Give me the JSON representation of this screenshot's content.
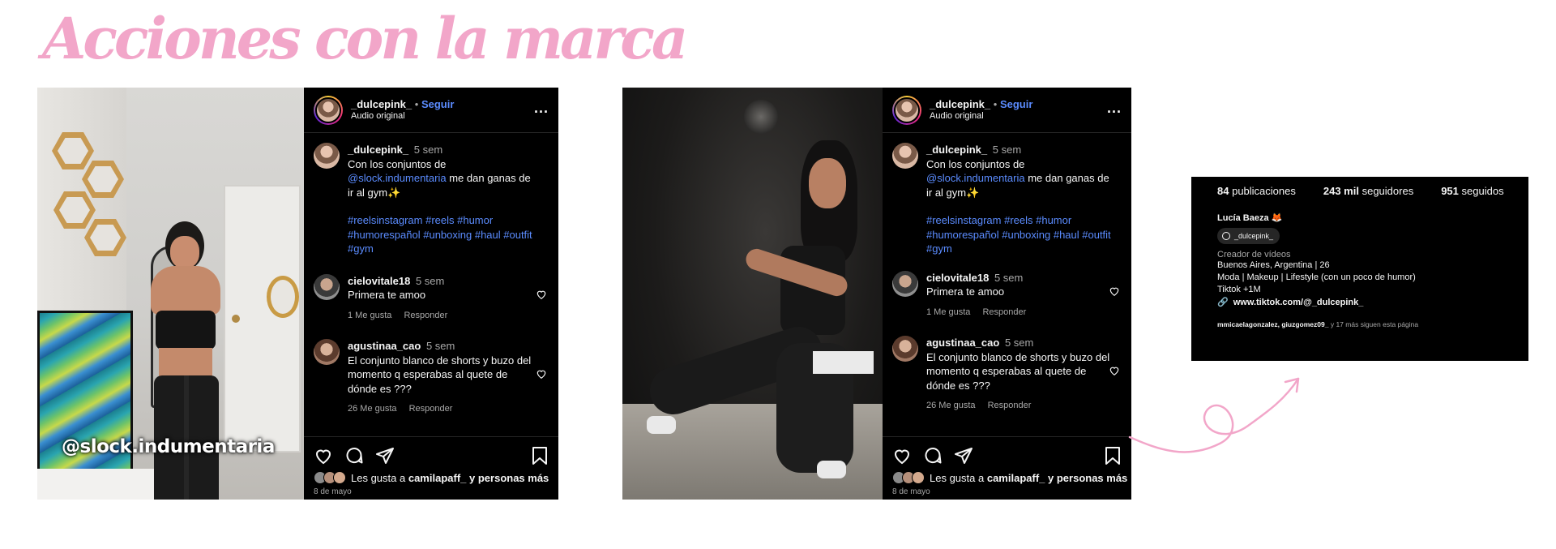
{
  "heading": "Acciones con la marca",
  "posts": [
    {
      "overlay_text": "@slock.indumentaria",
      "header": {
        "username": "_dulcepink_",
        "separator": "•",
        "follow": "Seguir",
        "audio": "Audio original",
        "more": "..."
      },
      "caption": {
        "username": "_dulcepink_",
        "time": "5 sem",
        "text_before": "Con los conjuntos de",
        "mention": "@slock.indumentaria",
        "text_after": "me dan ganas de ir al gym✨",
        "hashtags": "#reelsinstagram #reels #humor #humorespañol #unboxing #haul #outfit #gym"
      },
      "comments": [
        {
          "username": "cielovitale18",
          "time": "5 sem",
          "text": "Primera te amoo",
          "likes": "1 Me gusta",
          "reply": "Responder"
        },
        {
          "username": "agustinaa_cao",
          "time": "5 sem",
          "text": "El conjunto blanco de shorts y buzo del momento q esperabas al quete de dónde es ???",
          "likes": "26 Me gusta",
          "reply": "Responder"
        }
      ],
      "likes_prefix": "Les gusta a",
      "likes_user": "camilapaff_",
      "likes_suffix": "y personas más",
      "date": "8 de mayo"
    },
    {
      "header": {
        "username": "_dulcepink_",
        "separator": "•",
        "follow": "Seguir",
        "audio": "Audio original",
        "more": "..."
      },
      "caption": {
        "username": "_dulcepink_",
        "time": "5 sem",
        "text_before": "Con los conjuntos de",
        "mention": "@slock.indumentaria",
        "text_after": "me dan ganas de ir al gym✨",
        "hashtags": "#reelsinstagram #reels #humor #humorespañol #unboxing #haul #outfit #gym"
      },
      "comments": [
        {
          "username": "cielovitale18",
          "time": "5 sem",
          "text": "Primera te amoo",
          "likes": "1 Me gusta",
          "reply": "Responder"
        },
        {
          "username": "agustinaa_cao",
          "time": "5 sem",
          "text": "El conjunto blanco de shorts y buzo del momento q esperabas al quete de dónde es ???",
          "likes": "26 Me gusta",
          "reply": "Responder"
        }
      ],
      "likes_prefix": "Les gusta a",
      "likes_user": "camilapaff_",
      "likes_suffix": "y personas más",
      "date": "8 de mayo"
    }
  ],
  "profile": {
    "posts_count": "84",
    "posts_label": "publicaciones",
    "followers_count": "243 mil",
    "followers_label": "seguidores",
    "following_count": "951",
    "following_label": "seguidos",
    "name": "Lucía Baeza 🦊",
    "threads_handle": "_dulcepink_",
    "category": "Creador de vídeos",
    "bio": [
      "Buenos Aires, Argentina | 26",
      "Moda | Makeup | Lifestyle (con un poco de humor)",
      "Tiktok +1M"
    ],
    "link": "www.tiktok.com/@_dulcepink_",
    "followed_by_users": "mmicaelagonzalez, giuzgomez09_",
    "followed_by_suffix": "y 17 más siguen esta página"
  },
  "colors": {
    "accent_pink": "#f2a6c9",
    "link_blue": "#5b8cff",
    "background": "#000000"
  }
}
